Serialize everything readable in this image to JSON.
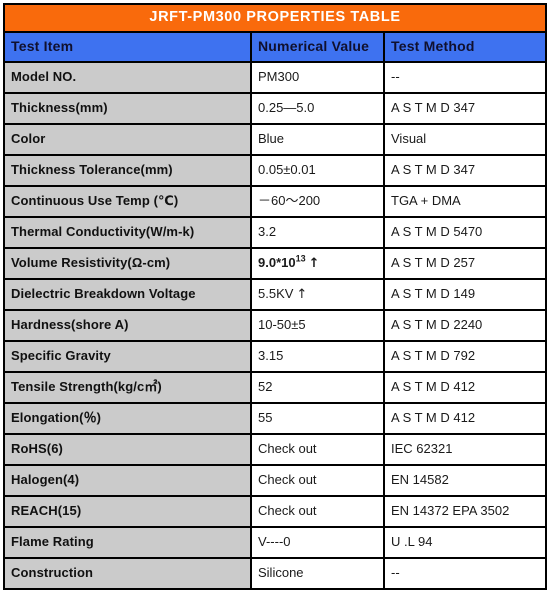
{
  "colors": {
    "title_bg": "#F96A0C",
    "title_fg": "#FFFFFF",
    "header_bg": "#3E72F0",
    "header_fg": "#10102E",
    "item_bg": "#CBCBCB",
    "cell_bg": "#FFFFFF",
    "border": "#000000",
    "page_bg": "#FFFFFF"
  },
  "title": "JRFT-PM300  PROPERTIES  TABLE",
  "columns": {
    "item": "Test Item",
    "value": "Numerical Value",
    "method": "Test Method"
  },
  "rows": [
    {
      "item": "Model NO.",
      "value": "PM300",
      "method": "--"
    },
    {
      "item": "Thickness(mm)",
      "value": "0.25—5.0",
      "method": "A S T M  D 347"
    },
    {
      "item": "Color",
      "value": "Blue",
      "method": "Visual"
    },
    {
      "item": "Thickness Tolerance(mm)",
      "value": "0.05±0.01",
      "method": "A S T M  D 347"
    },
    {
      "item": "Continuous Use Temp (℃)",
      "value": "－60～200",
      "method": "TGA + DMA"
    },
    {
      "item": "Thermal Conductivity(W/m-k)",
      "value": "3.2",
      "method": "A S T M  D 5470"
    },
    {
      "item": "Volume Resistivity(Ω-cm)",
      "value": "9.0*10",
      "value_sup": "13",
      "value_suffix": "↑",
      "value_bold": true,
      "method": "A S T M  D 257"
    },
    {
      "item": "Dielectric Breakdown Voltage",
      "value": "5.5KV",
      "value_suffix": "↑",
      "method": "A S T M  D 149"
    },
    {
      "item": "Hardness(shore A)",
      "value": "10-50±5",
      "method": "A S T M  D 2240"
    },
    {
      "item": "Specific Gravity",
      "value": "3.15",
      "method": "A S T M  D 792"
    },
    {
      "item": "Tensile Strength(kg/c㎡)",
      "value": "52",
      "method": "A S T M  D 412"
    },
    {
      "item": "Elongation(％)",
      "value": "55",
      "method": "A S T M  D 412"
    },
    {
      "item": "RoHS(6)",
      "value": "Check out",
      "method": "IEC 62321"
    },
    {
      "item": "Halogen(4)",
      "value": "Check out",
      "method": "EN 14582"
    },
    {
      "item": "REACH(15)",
      "value": "Check out",
      "method": "EN 14372 EPA 3502"
    },
    {
      "item": "Flame Rating",
      "value": "V----0",
      "method": "U .L 94"
    },
    {
      "item": "Construction",
      "value": "Silicone",
      "method": "--"
    }
  ]
}
